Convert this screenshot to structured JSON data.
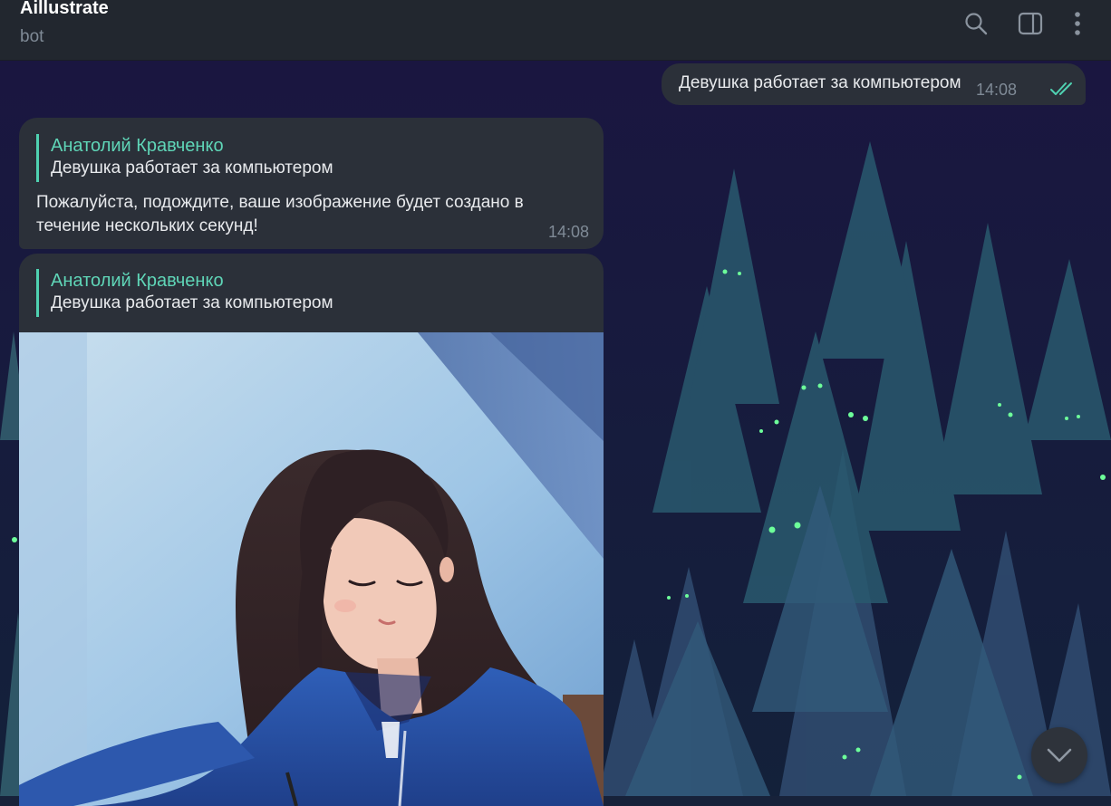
{
  "header": {
    "title": "Aillustrate",
    "subtitle": "bot",
    "icons": [
      "search-icon",
      "sidebar-toggle-icon",
      "more-vertical-icon"
    ]
  },
  "messages": {
    "outgoing": {
      "text": "Девушка работает за компьютером",
      "time": "14:08",
      "status_icon": "double-check-icon"
    },
    "incoming": [
      {
        "reply_author": "Анатолий Кравченко",
        "reply_text": "Девушка работает за компьютером",
        "text": "Пожалуйста, подождите, ваше изображение будет создано в течение нескольких секунд!",
        "time": "14:08"
      },
      {
        "reply_author": "Анатолий Кравченко",
        "reply_text": "Девушка работает за компьютером",
        "media_icon": "generated-image"
      }
    ]
  },
  "scroll_button_icon": "chevron-down-icon",
  "colors": {
    "header_bg": "#22272f",
    "bubble_bg": "#2b3039",
    "accent": "#4fd1b1",
    "meta_text": "#7f8a96"
  }
}
